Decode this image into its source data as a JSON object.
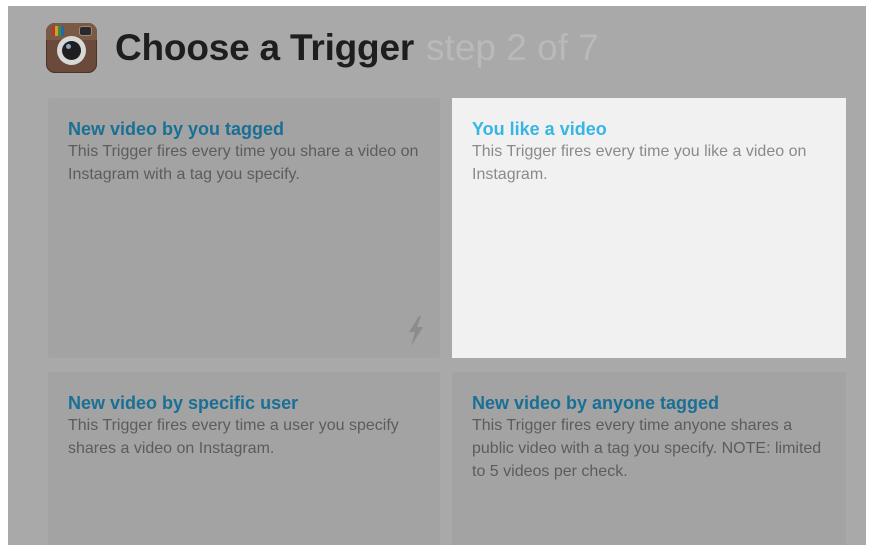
{
  "header": {
    "title": "Choose a Trigger",
    "step": "step 2 of 7",
    "app_icon": "instagram-camera-icon"
  },
  "colors": {
    "overlay_gray": "#a9a9a9",
    "card_gray": "#a3a3a3",
    "selected_card_bg": "#f1f1f1",
    "title_blue": "#1a6f94",
    "selected_title_blue": "#37b6e6"
  },
  "triggers": [
    {
      "title": "New video by you tagged",
      "description": "This Trigger fires every time you share a video on Instagram with a tag you specify.",
      "icon": "lightning-bolt-icon"
    },
    {
      "title": "You like a video",
      "description": "This Trigger fires every time you like a video on Instagram.",
      "selected": true
    },
    {
      "title": "New video by specific user",
      "description": "This Trigger fires every time a user you specify shares a video on Instagram."
    },
    {
      "title": "New video by anyone tagged",
      "description": "This Trigger fires every time anyone shares a public video with a tag you specify. NOTE: limited to 5 videos per check."
    }
  ]
}
